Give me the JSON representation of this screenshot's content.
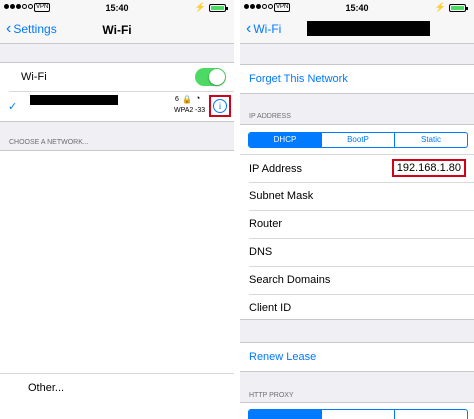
{
  "status": {
    "time": "15:40",
    "vpn": "VPN"
  },
  "left": {
    "nav": {
      "back_label": "Settings",
      "title": "Wi-Fi"
    },
    "wifi_label": "Wi-Fi",
    "network": {
      "channel": "6",
      "security": "WPA2",
      "signal": "-33"
    },
    "choose_header": "CHOOSE A NETWORK...",
    "other_label": "Other..."
  },
  "right": {
    "nav": {
      "back_label": "Wi-Fi"
    },
    "forget_label": "Forget This Network",
    "ip_header": "IP ADDRESS",
    "segments": [
      "DHCP",
      "BootP",
      "Static"
    ],
    "selected_segment": "DHCP",
    "rows": [
      {
        "label": "IP Address",
        "value": "192.168.1.80"
      },
      {
        "label": "Subnet Mask",
        "value": ""
      },
      {
        "label": "Router",
        "value": ""
      },
      {
        "label": "DNS",
        "value": ""
      },
      {
        "label": "Search Domains",
        "value": ""
      },
      {
        "label": "Client ID",
        "value": ""
      }
    ],
    "renew_label": "Renew Lease",
    "proxy_header": "HTTP PROXY"
  },
  "colors": {
    "accent": "#007aff",
    "toggle_on": "#4cd964",
    "highlight": "#d0021b"
  }
}
